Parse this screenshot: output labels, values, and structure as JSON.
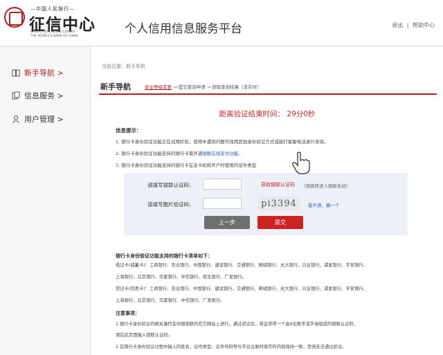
{
  "header": {
    "logo_top": "—中国人民银行—",
    "logo_name": "征信中心",
    "logo_en_line1": "CREDIT REFERENCE CENTER",
    "logo_en_line2": "THE PEOPLE'S BANK OF CHINA",
    "platform_title": "个人信用信息服务平台",
    "link_logout": "退出",
    "separator": "|",
    "link_help": "帮助中心"
  },
  "sidebar": {
    "items": [
      {
        "label": "新手导航 >",
        "icon": "book-icon"
      },
      {
        "label": "信息服务 >",
        "icon": "document-icon"
      },
      {
        "label": "用户管理 >",
        "icon": "user-icon"
      }
    ]
  },
  "main": {
    "breadcrumb": "当前位置：新手导航",
    "section_title": "新手导航",
    "steps": {
      "current": "安全等级变更",
      "rest": " → 提交查询申请 → 获取查询结果（非实时）"
    },
    "countdown": "距离验证结束时间： 29分0秒",
    "info_title": "信息提示：",
    "info_lines": [
      {
        "text": "1. 银行卡身份验证功能正在试用阶段，使用中遇到问题可改用其他身份验证方式或拨打客服电话进行咨询。",
        "link": ""
      },
      {
        "text": "2. 银行卡身份验证功能支持的银行卡需开通",
        "link": "银联在线支付功能。"
      },
      {
        "text": "3. 银行卡身份验证功能支持的银行卡在支卡机和开户时使用的证件类型",
        "link": ""
      }
    ],
    "form": {
      "label_code": "请填写银联认证码：",
      "get_code_link": "获取银联认证码",
      "get_code_hint": "（将跳转进入银联系统）",
      "label_captcha": "请填写图片验证码：",
      "captcha_text": "pi3394",
      "refresh_text": "看不清，换一个",
      "prev_button": "上一步",
      "submit_button": "提交"
    },
    "banks_title": "银行卡身份验证功能支持的银行卡清单如下：",
    "bank_lines": [
      "借记卡(储蓄卡)：工商银行、农业银行、中国银行、建设银行、交通银行、邮储银行、光大银行、兴业银行、浦发银行、平安银行、",
      "上海银行、北京银行、华夏银行、中信银行、民生银行、广发银行。",
      "贷记卡(信用卡)：工商银行、农业银行、中国银行、建设银行、交通银行、邮储银行、光大银行、兴业银行、浦发银行、平安银行、",
      "上海银行、北京银行、华夏银行、中信银行、广发银行。"
    ],
    "notes_title": "注意事项：",
    "note_lines": [
      "1.银行卡身份验证的相关操作在中国银联的官方网站上进行，通过验证后，将会获得一个由6位数字或字母组成的银联认证码，",
      "请在此页面输入银联认证码。",
      "2.在银行卡身份验证过程中输入的姓名、证件类型、证件号码等与平台注册时填写的内容保持一致，否则无法通过验证。"
    ]
  },
  "colors": {
    "accent": "#b11f1f",
    "countdown": "#c62828",
    "link": "#1d5fb2",
    "form_bg": "#eef0f8",
    "submit": "#cc2222",
    "prev": "#6f6f6f"
  }
}
